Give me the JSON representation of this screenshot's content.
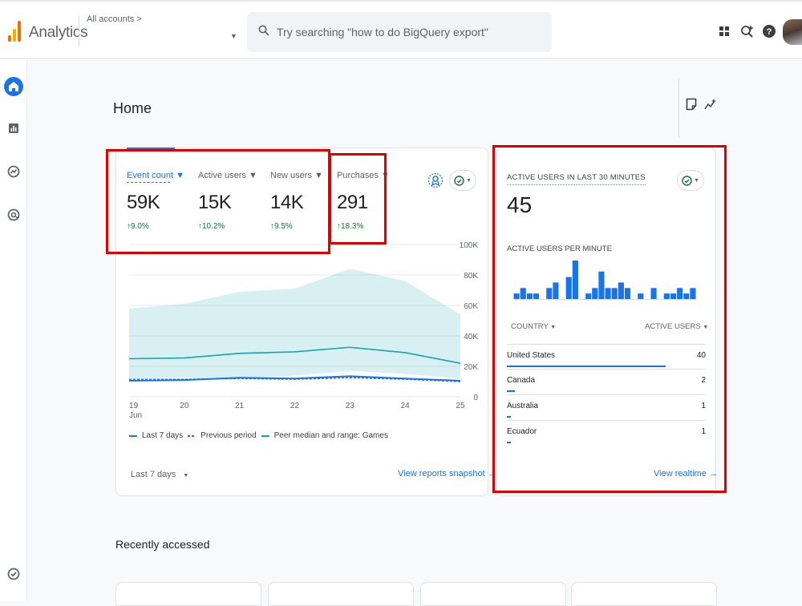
{
  "app": {
    "brand": "Analytics"
  },
  "account": {
    "label": "All accounts >"
  },
  "search": {
    "placeholder": "Try searching \"how to do BigQuery export\""
  },
  "page": {
    "title": "Home"
  },
  "metrics": [
    {
      "label": "Event count",
      "value": "59K",
      "delta": "9.0%"
    },
    {
      "label": "Active users",
      "value": "15K",
      "delta": "10.2%"
    },
    {
      "label": "New users",
      "value": "14K",
      "delta": "9.5%"
    },
    {
      "label": "Purchases",
      "value": "291",
      "delta": "18.3%"
    }
  ],
  "chart_data": {
    "type": "line",
    "x": [
      "19",
      "20",
      "21",
      "22",
      "23",
      "24",
      "25"
    ],
    "x_sublabel": "Jun",
    "ylim": [
      0,
      100000
    ],
    "y_ticks": [
      "100K",
      "80K",
      "60K",
      "40K",
      "20K",
      "0"
    ],
    "series": [
      {
        "name": "Last 7 days",
        "values": [
          10500,
          11000,
          12500,
          12000,
          13500,
          12000,
          10500
        ],
        "color": "#1a73e8"
      },
      {
        "name": "Previous period",
        "values": [
          11500,
          11500,
          12000,
          11500,
          12500,
          11500,
          10000
        ],
        "color": "#1a73e8",
        "style": "dashed"
      },
      {
        "name": "Peer median and range: Games",
        "values": [
          25000,
          25500,
          28500,
          29500,
          32500,
          29000,
          22000
        ],
        "range_low": [
          12000,
          12500,
          12000,
          14000,
          17000,
          15000,
          12000
        ],
        "range_high": [
          58000,
          61000,
          69000,
          71000,
          84000,
          76000,
          54000
        ],
        "color": "#12a4af"
      }
    ],
    "legend_position": "bottom-left",
    "grid": true
  },
  "card_footer": {
    "range": "Last 7 days",
    "link": "View reports snapshot"
  },
  "realtime": {
    "title": "ACTIVE USERS IN LAST 30 MINUTES",
    "value": "45",
    "subtitle": "ACTIVE USERS PER MINUTE",
    "per_minute": [
      1,
      2,
      1,
      1,
      0,
      2,
      3,
      0,
      4,
      7,
      0,
      1,
      2,
      5,
      2,
      2,
      3,
      2,
      0,
      1,
      0,
      2,
      0,
      1,
      1,
      2,
      1,
      2
    ],
    "col_country": "COUNTRY",
    "col_users": "ACTIVE USERS",
    "rows": [
      {
        "country": "United States",
        "value": "40",
        "share": 0.889
      },
      {
        "country": "Canada",
        "value": "2",
        "share": 0.044
      },
      {
        "country": "Australia",
        "value": "1",
        "share": 0.022
      },
      {
        "country": "Ecuador",
        "value": "1",
        "share": 0.022
      }
    ],
    "link": "View realtime"
  },
  "recent": {
    "title": "Recently accessed"
  },
  "colors": {
    "accent": "#1a73e8",
    "positive": "#137333",
    "highlight": "#e00000"
  }
}
